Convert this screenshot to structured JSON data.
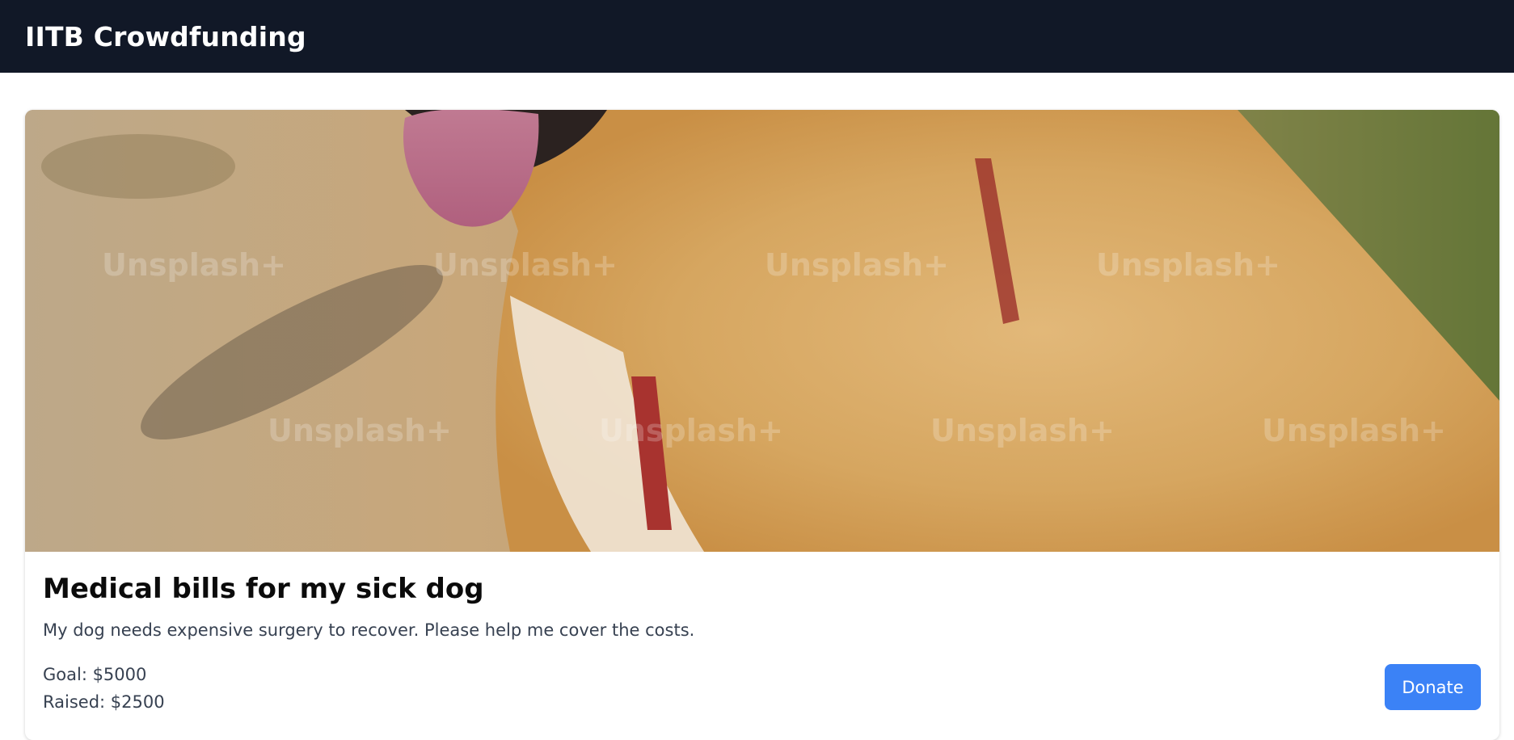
{
  "navbar": {
    "brand": "IITB Crowdfunding"
  },
  "campaign": {
    "image_alt": "Golden retriever with red collar",
    "watermark": "Unsplash+",
    "title": "Medical bills for my sick dog",
    "description": "My dog needs expensive surgery to recover. Please help me cover the costs.",
    "goal_text": "Goal: $5000",
    "raised_text": "Raised: $2500",
    "donate_label": "Donate"
  },
  "colors": {
    "navbar_bg": "#111827",
    "accent": "#3b82f6"
  }
}
